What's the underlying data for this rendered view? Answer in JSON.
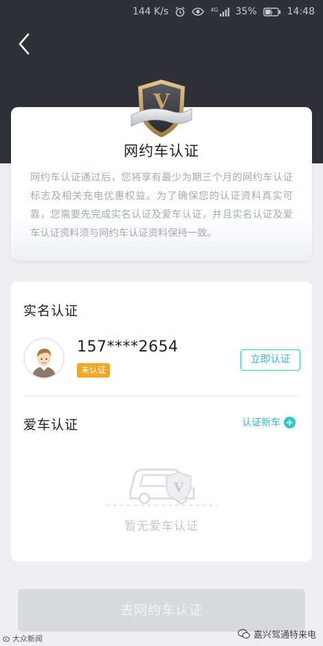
{
  "status_bar": {
    "network_speed": "144 K/s",
    "signal_label": "4G",
    "battery": "35%",
    "time": "14:48"
  },
  "intro": {
    "title": "网约车认证",
    "description": "网约车认证通过后，您将享有最少为期三个月的网约车认证标志及相关充电优惠权益。为了确保您的认证资料真实可靠，您需要先完成实名认证及爱车认证，并且实名认证及爱车认证资料须与网约车认证资料保持一致。"
  },
  "identity": {
    "section_title": "实名认证",
    "phone": "157****2654",
    "status": "未认证",
    "verify_button": "立即认证"
  },
  "car": {
    "section_title": "爱车认证",
    "add_label": "认证新车",
    "empty_text": "暂无爱车认证",
    "empty_badge_letter": "V"
  },
  "cta": {
    "label": "去网约车认证"
  },
  "badge": {
    "letter": "V"
  },
  "watermarks": {
    "left": "大众新闻",
    "right": "嘉兴驾通特来电"
  },
  "colors": {
    "header_bg": "#2f3038",
    "accent": "#2ec7c9",
    "status_badge": "#f5a623",
    "page_bg": "#efeff1"
  },
  "icons": [
    "back-arrow-icon",
    "alarm-icon",
    "eye-icon",
    "signal-icon",
    "battery-icon",
    "shield-badge-icon",
    "avatar-icon",
    "plus-icon",
    "car-icon"
  ]
}
